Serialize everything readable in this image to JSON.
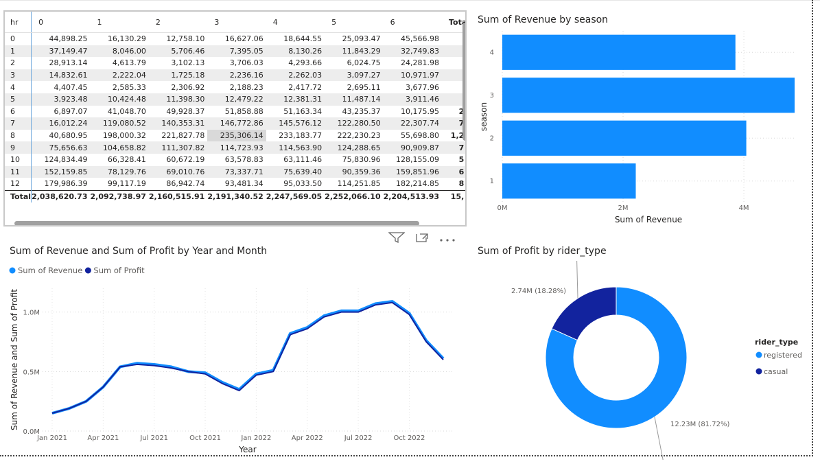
{
  "matrix": {
    "row_header": "hr",
    "columns": [
      "0",
      "1",
      "2",
      "3",
      "4",
      "5",
      "6",
      "Tota"
    ],
    "rows": [
      {
        "hr": "0",
        "values": [
          "44,898.25",
          "16,130.29",
          "12,758.10",
          "16,627.06",
          "18,644.55",
          "25,093.47",
          "45,566.98",
          ""
        ]
      },
      {
        "hr": "1",
        "values": [
          "37,149.47",
          "8,046.00",
          "5,706.46",
          "7,395.05",
          "8,130.26",
          "11,843.29",
          "32,749.83",
          ""
        ]
      },
      {
        "hr": "2",
        "values": [
          "28,913.14",
          "4,613.79",
          "3,102.13",
          "3,706.03",
          "4,293.66",
          "6,024.75",
          "24,281.98",
          ""
        ]
      },
      {
        "hr": "3",
        "values": [
          "14,832.61",
          "2,222.04",
          "1,725.18",
          "2,236.16",
          "2,262.03",
          "3,097.27",
          "10,971.97",
          ""
        ]
      },
      {
        "hr": "4",
        "values": [
          "4,407.45",
          "2,585.33",
          "2,306.92",
          "2,188.23",
          "2,417.72",
          "2,695.11",
          "3,677.96",
          ""
        ]
      },
      {
        "hr": "5",
        "values": [
          "3,923.48",
          "10,424.48",
          "11,398.30",
          "12,479.22",
          "12,381.31",
          "11,487.14",
          "3,911.46",
          ""
        ]
      },
      {
        "hr": "6",
        "values": [
          "6,897.07",
          "41,048.70",
          "49,928.37",
          "51,858.88",
          "51,163.34",
          "43,235.37",
          "10,175.95",
          "2"
        ]
      },
      {
        "hr": "7",
        "values": [
          "16,012.24",
          "119,080.52",
          "140,353.31",
          "146,772.86",
          "145,576.12",
          "122,280.50",
          "22,307.74",
          "7"
        ]
      },
      {
        "hr": "8",
        "values": [
          "40,680.95",
          "198,000.32",
          "221,827.78",
          "235,306.14",
          "233,183.77",
          "222,230.23",
          "55,698.80",
          "1,2"
        ]
      },
      {
        "hr": "9",
        "values": [
          "75,656.63",
          "104,658.82",
          "111,307.82",
          "114,723.93",
          "114,563.90",
          "124,288.65",
          "90,909.87",
          "7"
        ]
      },
      {
        "hr": "10",
        "values": [
          "124,834.49",
          "66,328.41",
          "60,672.19",
          "63,578.83",
          "63,111.46",
          "75,830.96",
          "128,155.09",
          "5"
        ]
      },
      {
        "hr": "11",
        "values": [
          "152,159.85",
          "78,129.76",
          "69,010.76",
          "73,337.71",
          "75,639.40",
          "90,359.36",
          "159,851.96",
          "6"
        ]
      },
      {
        "hr": "12",
        "values": [
          "179,986.39",
          "99,117.19",
          "86,942.74",
          "93,481.34",
          "95,033.50",
          "114,251.85",
          "182,214.85",
          "8"
        ]
      }
    ],
    "total": {
      "label": "Total",
      "values": [
        "2,038,620.73",
        "2,092,738.97",
        "2,160,515.91",
        "2,191,340.52",
        "2,247,569.05",
        "2,252,066.10",
        "2,204,513.93",
        "15,"
      ]
    }
  },
  "bar_title": "Sum of Revenue by season",
  "line_title": "Sum of Revenue and Sum of Profit by Year and Month",
  "donut_title": "Sum of Profit by rider_type",
  "icons": [
    "filter-icon",
    "focus-mode-icon",
    "more-options-icon"
  ],
  "colors": {
    "revenue": "#118dff",
    "profit": "#12239e",
    "bar": "#118dff",
    "grid": "#d0d0d0"
  },
  "chart_data": [
    {
      "type": "bar",
      "orientation": "horizontal",
      "title": "Sum of Revenue by season",
      "xlabel": "Sum of Revenue",
      "ylabel": "season",
      "categories": [
        "4",
        "3",
        "2",
        "1"
      ],
      "values": [
        3.86,
        4.84,
        4.04,
        2.21
      ],
      "value_unit": "M",
      "xlim": [
        0,
        4.84
      ],
      "xticks": [
        "0M",
        "2M",
        "4M"
      ],
      "grid": true
    },
    {
      "type": "line",
      "title": "Sum of Revenue and Sum of Profit by Year and Month",
      "xlabel": "Year",
      "ylabel": "Sum of Revenue and Sum of Profit",
      "x_ticks": [
        "Jan 2021",
        "Apr 2021",
        "Jul 2021",
        "Oct 2021",
        "Jan 2022",
        "Apr 2022",
        "Jul 2022",
        "Oct 2022"
      ],
      "yticks": [
        "0.0M",
        "0.5M",
        "1.0M"
      ],
      "ylim": [
        0,
        1.2
      ],
      "legend": "top-left",
      "x": [
        "2021-01",
        "2021-02",
        "2021-03",
        "2021-04",
        "2021-05",
        "2021-06",
        "2021-07",
        "2021-08",
        "2021-09",
        "2021-10",
        "2021-11",
        "2021-12",
        "2022-01",
        "2022-02",
        "2022-03",
        "2022-04",
        "2022-05",
        "2022-06",
        "2022-07",
        "2022-08",
        "2022-09",
        "2022-10",
        "2022-11",
        "2022-12"
      ],
      "series": [
        {
          "name": "Sum of Revenue",
          "values": [
            0.15,
            0.19,
            0.25,
            0.37,
            0.54,
            0.57,
            0.56,
            0.54,
            0.5,
            0.49,
            0.41,
            0.35,
            0.48,
            0.51,
            0.82,
            0.87,
            0.97,
            1.01,
            1.01,
            1.07,
            1.09,
            0.99,
            0.76,
            0.61
          ]
        },
        {
          "name": "Sum of Profit",
          "values": [
            0.15,
            0.19,
            0.25,
            0.37,
            0.54,
            0.56,
            0.55,
            0.53,
            0.5,
            0.48,
            0.4,
            0.34,
            0.47,
            0.5,
            0.81,
            0.86,
            0.96,
            1.0,
            1.0,
            1.06,
            1.08,
            0.98,
            0.75,
            0.6
          ]
        }
      ]
    },
    {
      "type": "pie",
      "variant": "donut",
      "title": "Sum of Profit by rider_type",
      "legend_title": "rider_type",
      "legend": "right",
      "slices": [
        {
          "name": "registered",
          "value": 12.23,
          "percent": 81.72,
          "label": "12.23M (81.72%)"
        },
        {
          "name": "casual",
          "value": 2.74,
          "percent": 18.28,
          "label": "2.74M (18.28%)"
        }
      ]
    }
  ]
}
